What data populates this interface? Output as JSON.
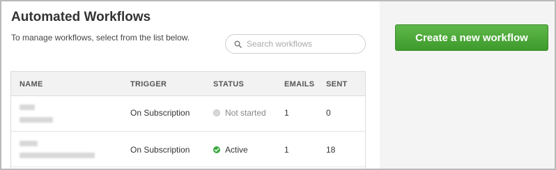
{
  "header": {
    "title": "Automated Workflows",
    "subtitle": "To manage workflows, select from the list below."
  },
  "search": {
    "placeholder": "Search workflows",
    "icon": "search-icon"
  },
  "create_button": {
    "label": "Create a new workflow",
    "color": "#4aa838"
  },
  "table": {
    "columns": [
      "NAME",
      "TRIGGER",
      "STATUS",
      "EMAILS",
      "SENT"
    ],
    "rows": [
      {
        "trigger": "On Subscription",
        "status": "Not started",
        "status_icon": "status-dot-grey",
        "emails": "1",
        "sent": "0"
      },
      {
        "trigger": "On Subscription",
        "status": "Active",
        "status_icon": "check-circle-icon",
        "emails": "1",
        "sent": "18"
      }
    ]
  }
}
